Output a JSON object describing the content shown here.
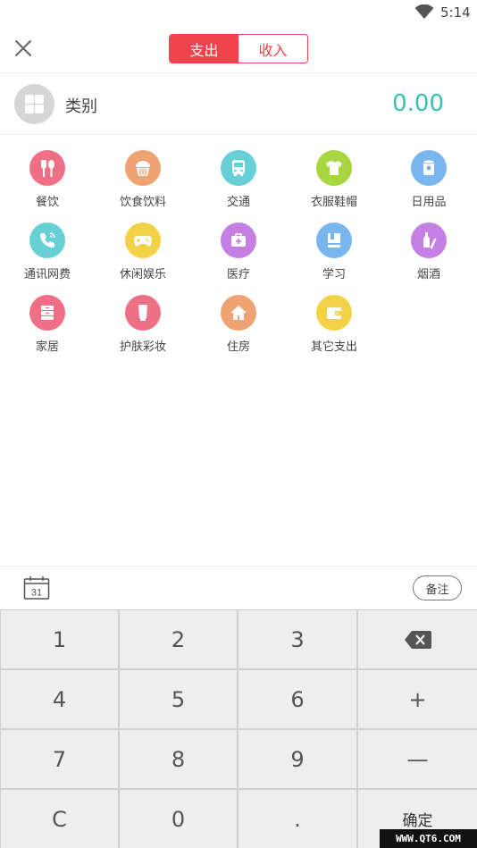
{
  "status_bar": {
    "time": "5:14"
  },
  "header": {
    "close_icon": "close-icon",
    "tabs": [
      {
        "label": "支出",
        "active": true
      },
      {
        "label": "收入",
        "active": false
      }
    ]
  },
  "category": {
    "label": "类别",
    "amount": "0.00"
  },
  "categories": [
    {
      "label": "餐饮",
      "icon": "utensils-icon",
      "color": "#ef6f86"
    },
    {
      "label": "饮食饮料",
      "icon": "cupcake-icon",
      "color": "#f0a372"
    },
    {
      "label": "交通",
      "icon": "bus-icon",
      "color": "#67d0d6"
    },
    {
      "label": "衣服鞋帽",
      "icon": "shirt-icon",
      "color": "#a8d640"
    },
    {
      "label": "日用品",
      "icon": "tissue-icon",
      "color": "#79b6ee"
    },
    {
      "label": "通讯网费",
      "icon": "phone-icon",
      "color": "#67d0d6"
    },
    {
      "label": "休闲娱乐",
      "icon": "gamepad-icon",
      "color": "#f4d247"
    },
    {
      "label": "医疗",
      "icon": "medkit-icon",
      "color": "#c57ee1"
    },
    {
      "label": "学习",
      "icon": "book-icon",
      "color": "#79b6ee"
    },
    {
      "label": "烟酒",
      "icon": "bottle-icon",
      "color": "#c57ee1"
    },
    {
      "label": "家居",
      "icon": "cabinet-icon",
      "color": "#ef6f86"
    },
    {
      "label": "护肤彩妆",
      "icon": "lotion-icon",
      "color": "#ef6f86"
    },
    {
      "label": "住房",
      "icon": "house-icon",
      "color": "#f0a372"
    },
    {
      "label": "其它支出",
      "icon": "wallet-icon",
      "color": "#f4d247"
    }
  ],
  "toolbar": {
    "calendar_day": "31",
    "memo_label": "备注"
  },
  "keypad": {
    "keys": [
      "1",
      "2",
      "3",
      "",
      "4",
      "5",
      "6",
      "+",
      "7",
      "8",
      "9",
      "—",
      "C",
      "0",
      ".",
      "确定"
    ],
    "backspace_icon": "backspace-icon"
  },
  "watermark": "WWW.QT6.COM"
}
